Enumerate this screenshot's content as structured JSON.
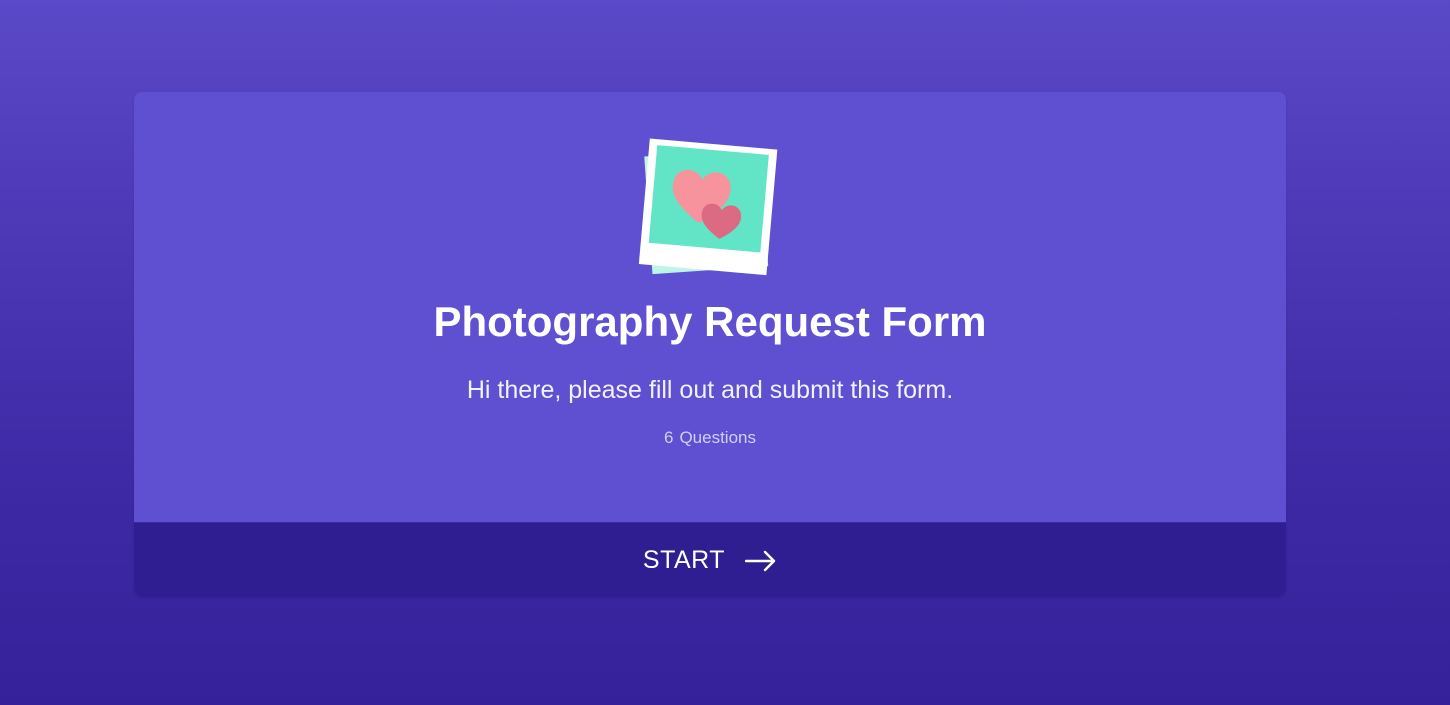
{
  "form": {
    "title": "Photography Request Form",
    "description": "Hi there, please fill out and submit this form.",
    "question_count": "6",
    "question_label": "Questions",
    "start_label": "START"
  },
  "icons": {
    "illustration": "polaroid-hearts-icon",
    "start_arrow": "arrow-right-icon"
  },
  "colors": {
    "background_top": "#5a49c8",
    "background_bottom": "#35229a",
    "card": "#5e50d0",
    "footer": "#2e1e92",
    "photo_fill": "#62e5c6",
    "heart_light": "#f7939d",
    "heart_dark": "#dc6a82"
  }
}
